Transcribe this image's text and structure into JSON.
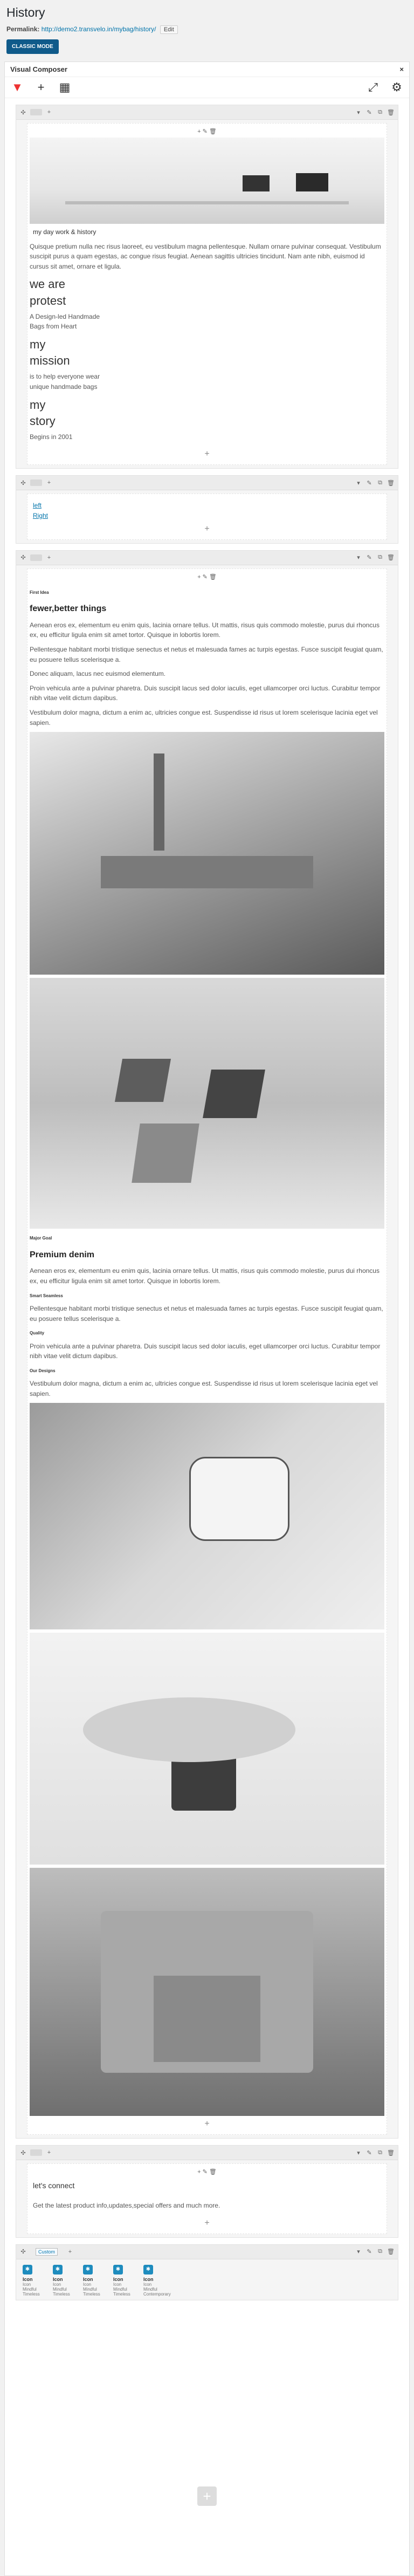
{
  "page": {
    "title": "History",
    "permalink_label": "Permalink:",
    "permalink_url": "http://demo2.transvelo.in/mybag/history/",
    "edit_label": "Edit",
    "classic_mode_label": "CLASSIC MODE"
  },
  "vc": {
    "title": "Visual Composer",
    "close": "×"
  },
  "row1": {
    "caption": "my day work & history",
    "intro": "Quisque pretium nulla nec risus laoreet, eu vestibulum magna pellentesque. Nullam ornare pulvinar consequat. Vestibulum suscipit purus a quam egestas, ac congue risus feugiat. Aenean sagittis ultricies tincidunt. Nam ante nibh, euismod id cursus sit amet, ornare et ligula.",
    "h1": "we are",
    "h1b": "protest",
    "p1": "A Design-led Handmade",
    "p1b": "Bags from Heart",
    "h2": "my",
    "h2b": "mission",
    "p2": "is to help everyone wear",
    "p2b": "unique handmade bags",
    "h3": "my",
    "h3b": "story",
    "p3": "Begins in 2001"
  },
  "row2": {
    "link1": "left",
    "link2": "Right"
  },
  "row3": {
    "label1": "First Idea",
    "heading1": "fewer,better things",
    "para1": "Aenean eros ex, elementum eu enim quis, lacinia ornare tellus. Ut mattis, risus quis commodo molestie, purus dui rhoncus ex, eu efficitur ligula enim sit amet tortor. Quisque in lobortis lorem.",
    "para2": "Pellentesque habitant morbi tristique senectus et netus et malesuada fames ac turpis egestas. Fusce suscipit feugiat quam, eu posuere tellus scelerisque a.",
    "para3": "Donec aliquam, lacus nec euismod elementum.",
    "para4": "Proin vehicula ante a pulvinar pharetra. Duis suscipit lacus sed dolor iaculis, eget ullamcorper orci luctus. Curabitur tempor nibh vitae velit dictum dapibus.",
    "para5": "Vestibulum dolor magna, dictum a enim ac, ultricies congue est. Suspendisse id risus ut lorem scelerisque lacinia eget vel sapien.",
    "label2": "Major Goal",
    "heading2": "Premium denim",
    "para6": "Aenean eros ex, elementum eu enim quis, lacinia ornare tellus. Ut mattis, risus quis commodo molestie, purus dui rhoncus ex, eu efficitur ligula enim sit amet tortor. Quisque in lobortis lorem.",
    "label3": "Smart Seamless",
    "para7": "Pellentesque habitant morbi tristique senectus et netus et malesuada fames ac turpis egestas. Fusce suscipit feugiat quam, eu posuere tellus scelerisque a.",
    "label4": "Quality",
    "para8": "Proin vehicula ante a pulvinar pharetra. Duis suscipit lacus sed dolor iaculis, eget ullamcorper orci luctus. Curabitur tempor nibh vitae velit dictum dapibus.",
    "label5": "Our Designs",
    "para9": "Vestibulum dolor magna, dictum a enim ac, ultricies congue est. Suspendisse id risus ut lorem scelerisque lacinia eget vel sapien."
  },
  "row4": {
    "heading": "let's connect",
    "text": "Get the latest product info,updates,special offers and much more."
  },
  "row5": {
    "tab": "Custom",
    "icons": [
      {
        "title": "Icon",
        "line1": "Icon",
        "line2": "Mindful",
        "line3": "Timeless"
      },
      {
        "title": "Icon",
        "line1": "Icon",
        "line2": "Mindful",
        "line3": "Timeless"
      },
      {
        "title": "Icon",
        "line1": "Icon",
        "line2": "Mindful",
        "line3": "Timeless"
      },
      {
        "title": "Icon",
        "line1": "Icon",
        "line2": "Mindful",
        "line3": "Timeless"
      },
      {
        "title": "Icon",
        "line1": "Icon",
        "line2": "Mindful",
        "line3": "Contemporary"
      }
    ]
  },
  "icons": {
    "plus": "+",
    "grid": "▦",
    "fullscreen": "⤢",
    "settings": "⚙",
    "move": "✣",
    "edit": "✎",
    "copy": "⧉",
    "delete": "🗑",
    "collapse": "▾",
    "add_element": "+"
  }
}
